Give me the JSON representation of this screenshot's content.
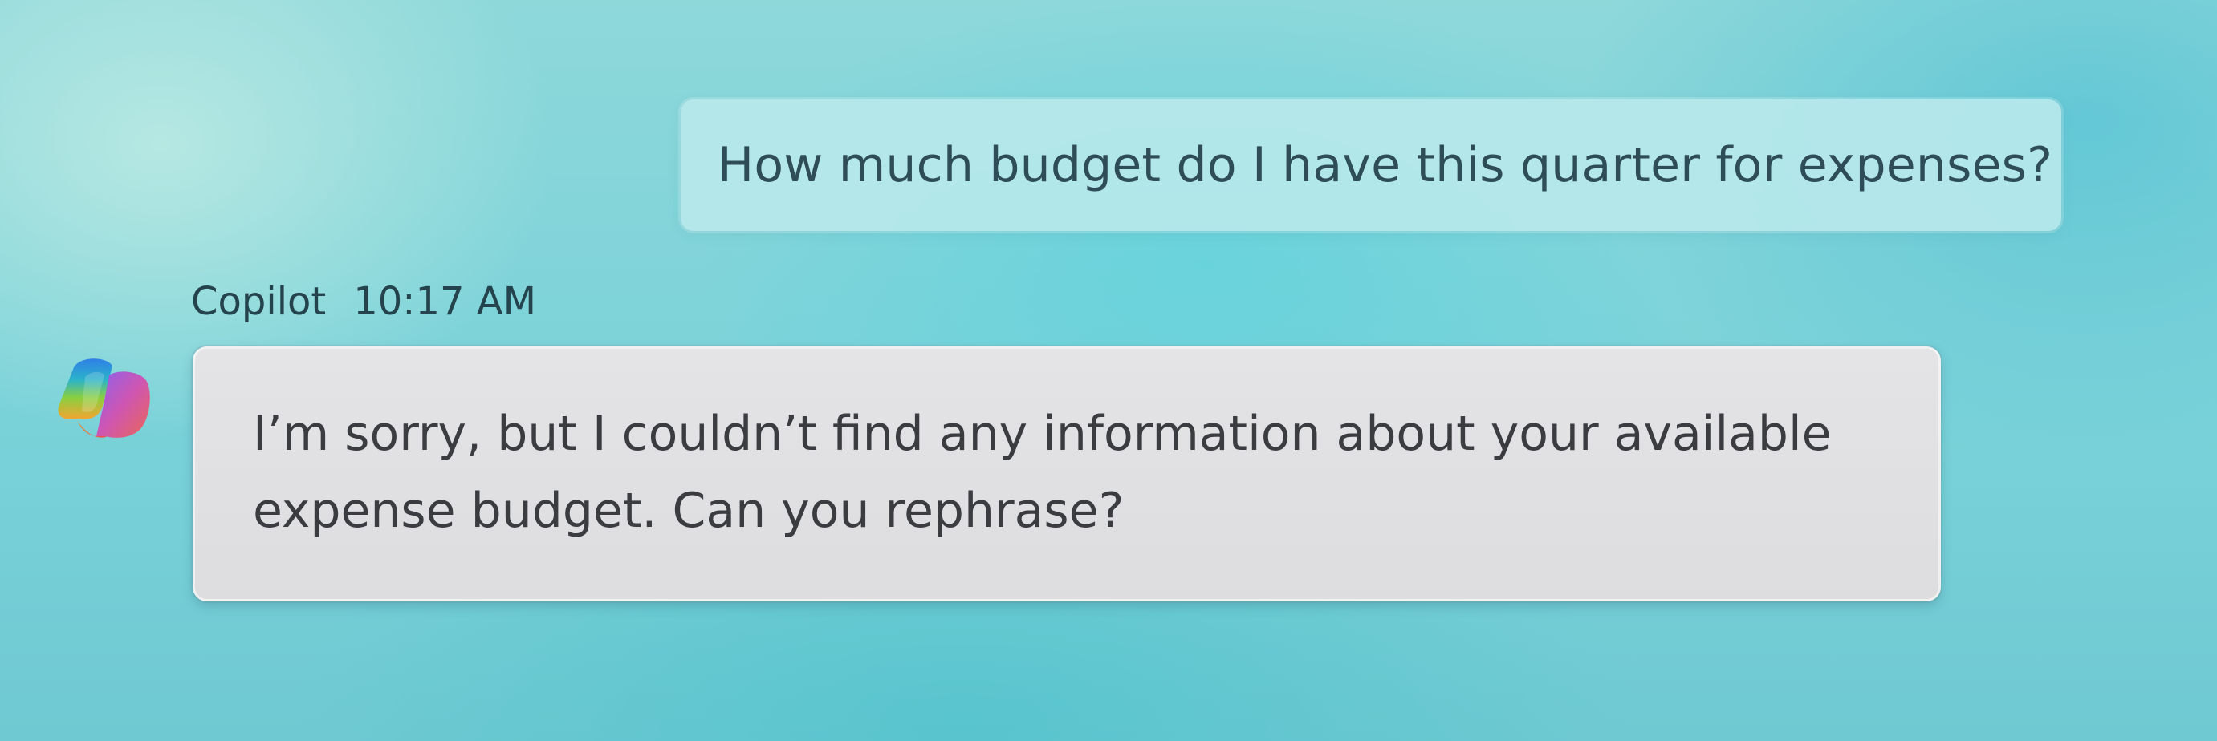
{
  "conversation": {
    "user_message": {
      "text": "How much budget do I have this quarter for expenses?"
    },
    "assistant_message": {
      "sender": "Copilot",
      "timestamp": "10:17 AM",
      "avatar_icon": "copilot-logo-icon",
      "text": "I’m sorry, but I couldn’t find any information about your available expense budget. Can you rephrase?"
    }
  },
  "colors": {
    "background": "#7ad2d9",
    "user_bubble": "#b7e8ec",
    "assistant_bubble": "#e2e2e4",
    "text_primary": "#2e4d57",
    "assistant_text": "#3a3c40"
  }
}
